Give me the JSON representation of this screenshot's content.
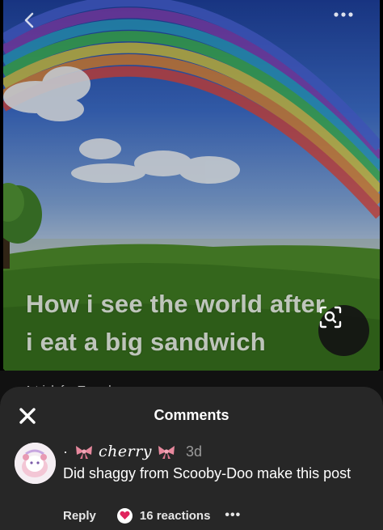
{
  "pin": {
    "meme_line1": "How i see the world after",
    "meme_line2": "i eat a big sandwich",
    "below_text": "A trick for Tuesday"
  },
  "icons": {
    "back": "chevron-left-icon",
    "more": "more-horizontal-icon",
    "visual_search": "lens-search-icon",
    "close": "close-icon",
    "reaction": "heart-icon"
  },
  "comments_sheet": {
    "title": "Comments",
    "comments": [
      {
        "prefix": "·",
        "username": "cherry",
        "timestamp": "3d",
        "text": "Did shaggy from Scooby-Doo make this post",
        "reply_label": "Reply",
        "reactions_label": "16 reactions",
        "more_label": "•••"
      }
    ]
  },
  "colors": {
    "sheet_background": "#272727",
    "reaction_heart": "#e0245e",
    "bow": "#e8899e"
  }
}
